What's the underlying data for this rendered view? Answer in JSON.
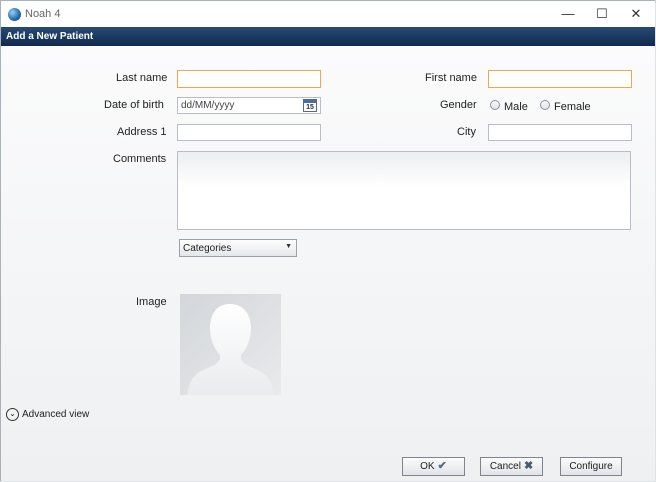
{
  "window": {
    "app_title": "Noah 4",
    "controls": {
      "minimize": "—",
      "maximize": "☐",
      "close": "✕"
    }
  },
  "header": {
    "title": "Add a New Patient"
  },
  "form": {
    "last_name": {
      "label": "Last name",
      "value": ""
    },
    "first_name": {
      "label": "First name",
      "value": ""
    },
    "date_of_birth": {
      "label": "Date of birth",
      "value": "dd/MM/yyyy",
      "calendar_day": "15"
    },
    "gender": {
      "label": "Gender",
      "options": [
        "Male",
        "Female"
      ],
      "selected": ""
    },
    "address1": {
      "label": "Address 1",
      "value": ""
    },
    "city": {
      "label": "City",
      "value": ""
    },
    "comments": {
      "label": "Comments",
      "value": ""
    },
    "categories": {
      "selected": "Categories",
      "arrow": "▼"
    },
    "image": {
      "label": "Image"
    }
  },
  "advanced": {
    "label": "Advanced view",
    "icon": "chevron-down-icon",
    "glyph": "⌄"
  },
  "buttons": {
    "ok": {
      "label": "OK",
      "icon": "checkmark-icon",
      "glyph": "✔"
    },
    "cancel": {
      "label": "Cancel",
      "icon": "cancel-x-icon",
      "glyph": "✖"
    },
    "configure": {
      "label": "Configure"
    }
  },
  "colors": {
    "header_bar": "#1b3a61",
    "required_border": "#f2a64b",
    "field_border": "#b9bec6"
  }
}
